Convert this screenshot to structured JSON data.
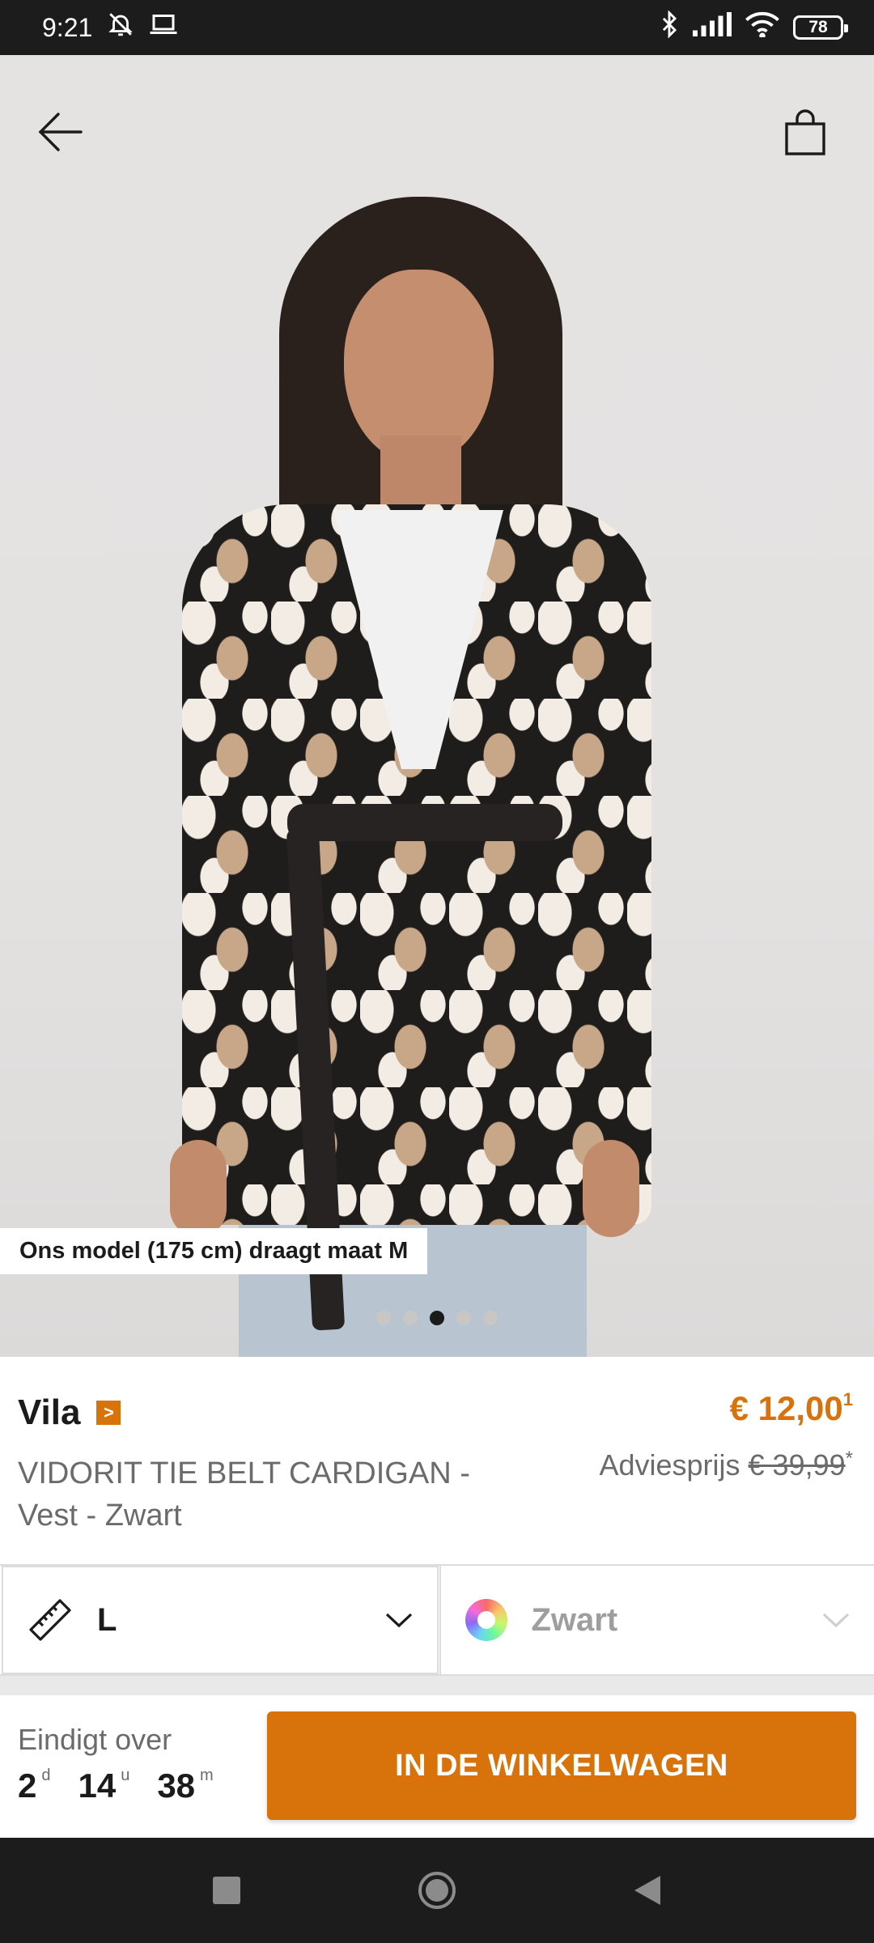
{
  "status_bar": {
    "time": "9:21",
    "battery": "78"
  },
  "hero": {
    "model_note": "Ons model (175 cm) draagt maat M",
    "image_count": 5,
    "active_image": 3
  },
  "product": {
    "brand": "Vila",
    "brand_badge": ">",
    "name": "VIDORIT TIE BELT CARDIGAN - Vest - Zwart",
    "price": "€ 12,00",
    "price_footnote": "1",
    "rrp_label": "Adviesprijs",
    "rrp_value": "€ 39,99",
    "rrp_footnote": "*"
  },
  "selectors": {
    "size_value": "L",
    "color_value": "Zwart"
  },
  "footer": {
    "ends_label": "Eindigt over",
    "days": "2",
    "days_unit": "d",
    "hours": "14",
    "hours_unit": "u",
    "minutes": "38",
    "minutes_unit": "m",
    "cta_label": "IN DE WINKELWAGEN"
  },
  "colors": {
    "accent": "#d8720a",
    "text_dark": "#1b1b1b",
    "text_muted": "#6b6b6b",
    "system_bar": "#1c1c1c"
  },
  "icons": {
    "back": "arrow-left-icon",
    "cart": "shopping-bag-icon",
    "size": "ruler-icon",
    "color": "color-wheel-icon",
    "dropdown": "chevron-down-icon"
  }
}
